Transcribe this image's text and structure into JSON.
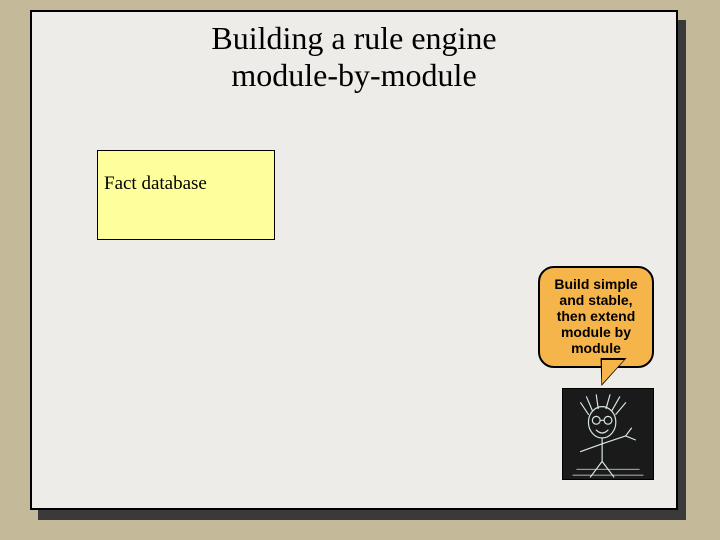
{
  "title_line1": "Building a rule engine",
  "title_line2": "module-by-module",
  "fact_box": "Fact database",
  "bubble_line1": "Build simple",
  "bubble_line2": "and stable,",
  "bubble_line3": "then extend",
  "bubble_line4": "module by",
  "bubble_line5": "module"
}
